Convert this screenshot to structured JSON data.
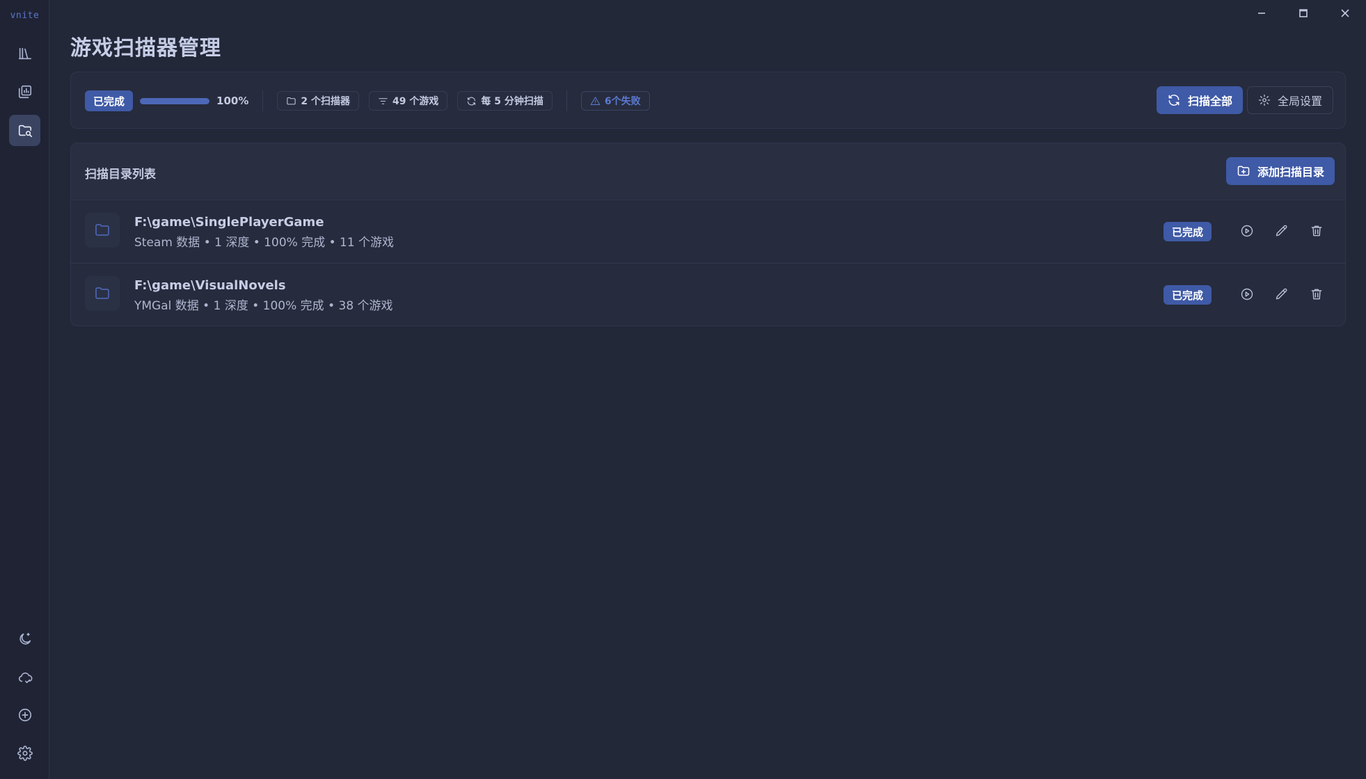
{
  "app": {
    "brand": "vnite"
  },
  "page": {
    "title": "游戏扫描器管理"
  },
  "status": {
    "state_badge": "已完成",
    "progress": 1.0,
    "progress_label": "100%",
    "scanners_chip": "2 个扫描器",
    "games_chip": "49 个游戏",
    "interval_chip": "每 5 分钟扫描",
    "failures_chip": "6个失败",
    "scan_all_label": "扫描全部",
    "global_settings_label": "全局设置"
  },
  "list": {
    "title": "扫描目录列表",
    "add_label": "添加扫描目录",
    "rows": [
      {
        "path": "F:\\game\\SinglePlayerGame",
        "meta": "Steam 数据 • 1 深度 • 100% 完成 • 11 个游戏",
        "badge": "已完成"
      },
      {
        "path": "F:\\game\\VisualNovels",
        "meta": "YMGal 数据 • 1 深度 • 100% 完成 • 38 个游戏",
        "badge": "已完成"
      }
    ]
  },
  "colors": {
    "accent": "#3f5aa6",
    "background": "#232839",
    "sidebar": "#1f2334",
    "failure": "#5c7ad0"
  },
  "icons": {
    "sidebar_top": [
      "library-icon",
      "stats-icon",
      "scanner-icon"
    ],
    "sidebar_bottom": [
      "moon-icon",
      "cloud-icon",
      "add-circle-icon",
      "gear-icon"
    ]
  }
}
